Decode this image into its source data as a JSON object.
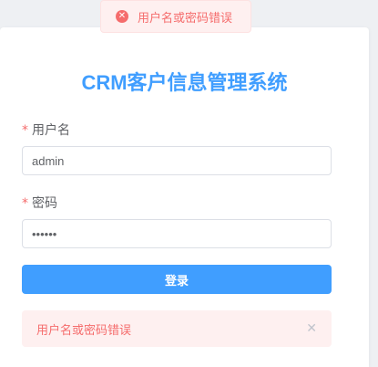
{
  "toast": {
    "icon": "error-circle-icon",
    "icon_glyph": "✕",
    "message": "用户名或密码错误"
  },
  "login": {
    "title": "CRM客户信息管理系统",
    "username": {
      "required_mark": "*",
      "label": "用户名",
      "value": "admin"
    },
    "password": {
      "required_mark": "*",
      "label": "密码",
      "value": "••••••"
    },
    "submit_label": "登录"
  },
  "alert": {
    "message": "用户名或密码错误",
    "close_icon": "close-icon",
    "close_glyph": "✕"
  },
  "colors": {
    "primary": "#409eff",
    "error": "#f56c6c",
    "error_bg": "#fef0f0"
  }
}
